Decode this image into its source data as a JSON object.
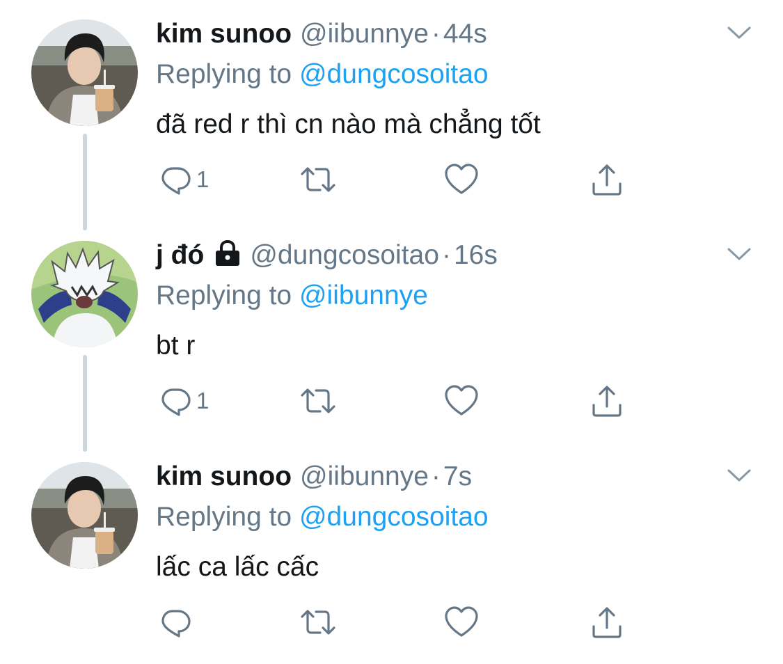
{
  "tweets": [
    {
      "name": "kim sunoo",
      "handle": "@iibunnye",
      "separator": "·",
      "time": "44s",
      "replying_prefix": "Replying to",
      "replying_to": "@dungcosoitao",
      "text": "đã red r thì cn nào mà chẳng tốt",
      "reply_count": "1",
      "locked": false,
      "avatar_icon": "profile-photo-boy-with-drink"
    },
    {
      "name": "j đó",
      "handle": "@dungcosoitao",
      "separator": "·",
      "time": "16s",
      "replying_prefix": "Replying to",
      "replying_to": "@iibunnye",
      "text": "bt r",
      "reply_count": "1",
      "locked": true,
      "avatar_icon": "anime-character-avatar"
    },
    {
      "name": "kim sunoo",
      "handle": "@iibunnye",
      "separator": "·",
      "time": "7s",
      "replying_prefix": "Replying to",
      "replying_to": "@dungcosoitao",
      "text": "lấc ca lấc cấc",
      "reply_count": "",
      "locked": false,
      "avatar_icon": "profile-photo-boy-with-drink"
    }
  ],
  "icons": {
    "reply": "reply-icon",
    "retweet": "retweet-icon",
    "like": "like-icon",
    "share": "share-icon",
    "more": "chevron-down-icon",
    "lock": "lock-icon"
  },
  "colors": {
    "text": "#14171a",
    "secondary": "#657786",
    "link": "#1da1f2",
    "thread_line": "#ccd6dd"
  }
}
